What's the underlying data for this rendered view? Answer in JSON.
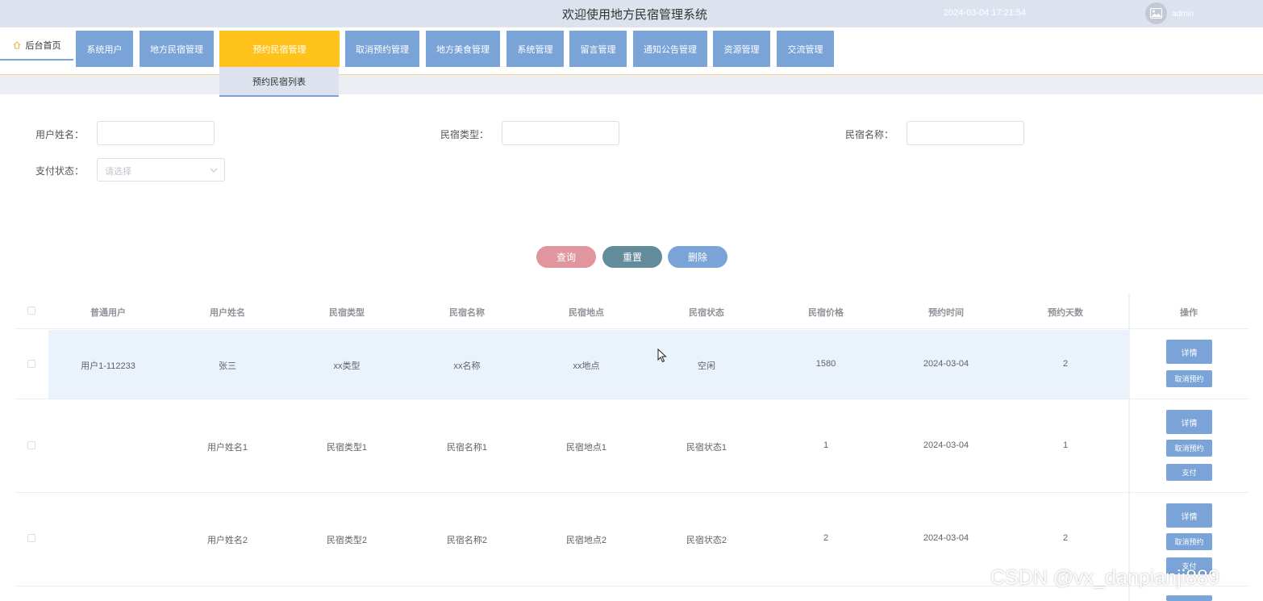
{
  "header": {
    "title": "欢迎使用地方民宿管理系统",
    "datetime": "2024-03-04 17:21:54",
    "username": "admin",
    "avatar_icon": "image-icon"
  },
  "nav": {
    "home": "后台首页",
    "items": [
      "系统用户",
      "地方民宿管理",
      "预约民宿管理",
      "取消预约管理",
      "地方美食管理",
      "系统管理",
      "留言管理",
      "通知公告管理",
      "资源管理",
      "交流管理"
    ],
    "active": "预约民宿管理",
    "submenu": "预约民宿列表"
  },
  "filters": {
    "username_label": "用户姓名：",
    "type_label": "民宿类型：",
    "name_label": "民宿名称：",
    "pay_label": "支付状态：",
    "pay_placeholder": "请选择"
  },
  "buttons": {
    "query": "查询",
    "reset": "重置",
    "delete": "删除"
  },
  "table": {
    "headers": [
      "普通用户",
      "用户姓名",
      "民宿类型",
      "民宿名称",
      "民宿地点",
      "民宿状态",
      "民宿价格",
      "预约时间",
      "预约天数",
      "操作"
    ],
    "rows": [
      {
        "cells": [
          "用户1-112233",
          "张三",
          "xx类型",
          "xx名称",
          "xx地点",
          "空闲",
          "1580",
          "2024-03-04",
          "2"
        ],
        "actions": [
          "详情",
          "取消预约"
        ]
      },
      {
        "cells": [
          "",
          "用户姓名1",
          "民宿类型1",
          "民宿名称1",
          "民宿地点1",
          "民宿状态1",
          "1",
          "2024-03-04",
          "1"
        ],
        "actions": [
          "详情",
          "取消预约",
          "支付"
        ]
      },
      {
        "cells": [
          "",
          "用户姓名2",
          "民宿类型2",
          "民宿名称2",
          "民宿地点2",
          "民宿状态2",
          "2",
          "2024-03-04",
          "2"
        ],
        "actions": [
          "详情",
          "取消预约",
          "支付"
        ]
      }
    ]
  },
  "watermark": "CSDN @vx_danpianji889",
  "colors": {
    "nav_blue": "#7aa4d8",
    "nav_active": "#ffc21a",
    "query": "#e0969c",
    "reset": "#628b9b",
    "delete": "#7aa4d8",
    "hover_row": "#eaf2fb"
  }
}
